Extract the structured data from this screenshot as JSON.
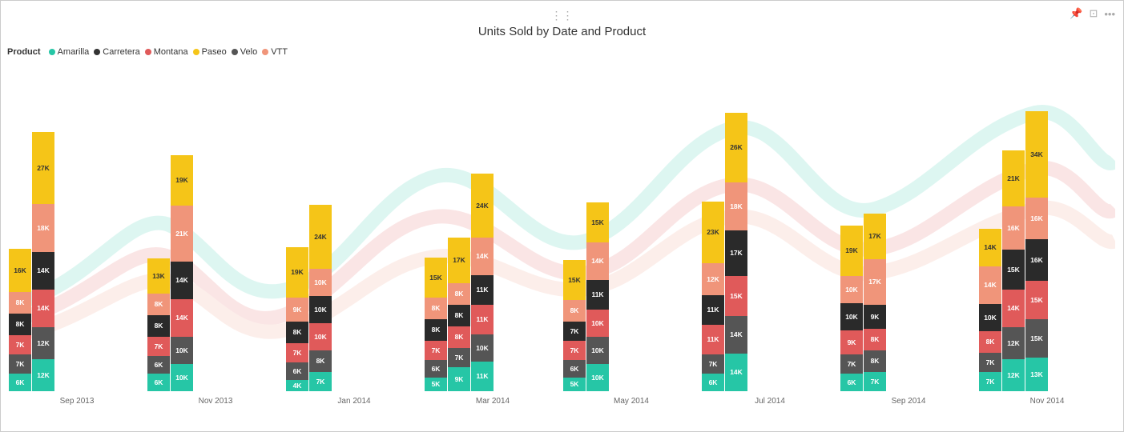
{
  "title": "Units Sold by Date and Product",
  "legend": {
    "label": "Product",
    "items": [
      {
        "name": "Amarilla",
        "color": "#26C6A6"
      },
      {
        "name": "Carretera",
        "color": "#333333"
      },
      {
        "name": "Montana",
        "color": "#E05A5A"
      },
      {
        "name": "Paseo",
        "color": "#F5C518"
      },
      {
        "name": "Velo",
        "color": "#555555"
      },
      {
        "name": "VTT",
        "color": "#F0957A"
      }
    ]
  },
  "colors": {
    "Amarilla": "#26C6A6",
    "Carretera": "#2a2a2a",
    "Montana": "#E05A5A",
    "Paseo": "#F5C518",
    "Velo": "#555555",
    "VTT": "#F0957A"
  },
  "xLabels": [
    "Sep 2013",
    "Nov 2013",
    "Jan 2014",
    "Mar 2014",
    "May 2014",
    "Jul 2014",
    "Sep 2014",
    "Nov 2014"
  ],
  "groups": [
    {
      "label": "Sep 2013",
      "stacks": [
        {
          "segments": [
            {
              "product": "Amarilla",
              "value": "6K",
              "height": 22,
              "color": "#26C6A6"
            },
            {
              "product": "Velo",
              "value": "7K",
              "height": 24,
              "color": "#555555"
            },
            {
              "product": "Montana",
              "value": "7K",
              "height": 24,
              "color": "#E05A5A"
            },
            {
              "product": "Carretera",
              "value": "8K",
              "height": 27,
              "color": "#2a2a2a"
            },
            {
              "product": "VTT",
              "value": "8K",
              "height": 27,
              "color": "#F0957A"
            },
            {
              "product": "Paseo",
              "value": "16K",
              "height": 54,
              "color": "#F5C518"
            }
          ]
        },
        {
          "segments": [
            {
              "product": "Amarilla",
              "value": "12K",
              "height": 40,
              "color": "#26C6A6"
            },
            {
              "product": "Velo",
              "value": "12K",
              "height": 40,
              "color": "#555555"
            },
            {
              "product": "Montana",
              "value": "14K",
              "height": 47,
              "color": "#E05A5A"
            },
            {
              "product": "Carretera",
              "value": "14K",
              "height": 47,
              "color": "#2a2a2a"
            },
            {
              "product": "VTT",
              "value": "18K",
              "height": 60,
              "color": "#F0957A"
            },
            {
              "product": "Paseo",
              "value": "27K",
              "height": 90,
              "color": "#F5C518"
            }
          ]
        }
      ]
    },
    {
      "label": "Nov 2013",
      "stacks": [
        {
          "segments": [
            {
              "product": "Amarilla",
              "value": "6K",
              "height": 22,
              "color": "#26C6A6"
            },
            {
              "product": "Velo",
              "value": "6K",
              "height": 22,
              "color": "#555555"
            },
            {
              "product": "Montana",
              "value": "7K",
              "height": 24,
              "color": "#E05A5A"
            },
            {
              "product": "Carretera",
              "value": "8K",
              "height": 27,
              "color": "#2a2a2a"
            },
            {
              "product": "VTT",
              "value": "8K",
              "height": 27,
              "color": "#F0957A"
            },
            {
              "product": "Paseo",
              "value": "13K",
              "height": 44,
              "color": "#F5C518"
            }
          ]
        },
        {
          "segments": [
            {
              "product": "Amarilla",
              "value": "10K",
              "height": 34,
              "color": "#26C6A6"
            },
            {
              "product": "Velo",
              "value": "10K",
              "height": 34,
              "color": "#555555"
            },
            {
              "product": "Montana",
              "value": "14K",
              "height": 47,
              "color": "#E05A5A"
            },
            {
              "product": "Carretera",
              "value": "14K",
              "height": 47,
              "color": "#2a2a2a"
            },
            {
              "product": "VTT",
              "value": "21K",
              "height": 70,
              "color": "#F0957A"
            },
            {
              "product": "Paseo",
              "value": "19K",
              "height": 63,
              "color": "#F5C518"
            }
          ]
        }
      ]
    },
    {
      "label": "Jan 2014",
      "stacks": [
        {
          "segments": [
            {
              "product": "Amarilla",
              "value": "4K",
              "height": 14,
              "color": "#26C6A6"
            },
            {
              "product": "Velo",
              "value": "6K",
              "height": 22,
              "color": "#555555"
            },
            {
              "product": "Montana",
              "value": "7K",
              "height": 24,
              "color": "#E05A5A"
            },
            {
              "product": "Carretera",
              "value": "8K",
              "height": 27,
              "color": "#2a2a2a"
            },
            {
              "product": "VTT",
              "value": "9K",
              "height": 30,
              "color": "#F0957A"
            },
            {
              "product": "Paseo",
              "value": "19K",
              "height": 63,
              "color": "#F5C518"
            }
          ]
        },
        {
          "segments": [
            {
              "product": "Amarilla",
              "value": "7K",
              "height": 24,
              "color": "#26C6A6"
            },
            {
              "product": "Velo",
              "value": "8K",
              "height": 27,
              "color": "#555555"
            },
            {
              "product": "Montana",
              "value": "10K",
              "height": 34,
              "color": "#E05A5A"
            },
            {
              "product": "Carretera",
              "value": "10K",
              "height": 34,
              "color": "#2a2a2a"
            },
            {
              "product": "VTT",
              "value": "10K",
              "height": 34,
              "color": "#F0957A"
            },
            {
              "product": "Paseo",
              "value": "24K",
              "height": 80,
              "color": "#F5C518"
            }
          ]
        }
      ]
    },
    {
      "label": "Mar 2014",
      "stacks": [
        {
          "segments": [
            {
              "product": "Amarilla",
              "value": "5K",
              "height": 17,
              "color": "#26C6A6"
            },
            {
              "product": "Velo",
              "value": "6K",
              "height": 22,
              "color": "#555555"
            },
            {
              "product": "Montana",
              "value": "7K",
              "height": 24,
              "color": "#E05A5A"
            },
            {
              "product": "Carretera",
              "value": "8K",
              "height": 27,
              "color": "#2a2a2a"
            },
            {
              "product": "VTT",
              "value": "8K",
              "height": 27,
              "color": "#F0957A"
            },
            {
              "product": "Paseo",
              "value": "15K",
              "height": 50,
              "color": "#F5C518"
            }
          ]
        },
        {
          "segments": [
            {
              "product": "Amarilla",
              "value": "9K",
              "height": 30,
              "color": "#26C6A6"
            },
            {
              "product": "Velo",
              "value": "7K",
              "height": 24,
              "color": "#555555"
            },
            {
              "product": "Montana",
              "value": "8K",
              "height": 27,
              "color": "#E05A5A"
            },
            {
              "product": "Carretera",
              "value": "8K",
              "height": 27,
              "color": "#2a2a2a"
            },
            {
              "product": "VTT",
              "value": "8K",
              "height": 27,
              "color": "#F0957A"
            },
            {
              "product": "Paseo",
              "value": "17K",
              "height": 57,
              "color": "#F5C518"
            }
          ]
        },
        {
          "segments": [
            {
              "product": "Amarilla",
              "value": "11K",
              "height": 37,
              "color": "#26C6A6"
            },
            {
              "product": "Velo",
              "value": "10K",
              "height": 34,
              "color": "#555555"
            },
            {
              "product": "Montana",
              "value": "11K",
              "height": 37,
              "color": "#E05A5A"
            },
            {
              "product": "Carretera",
              "value": "11K",
              "height": 37,
              "color": "#2a2a2a"
            },
            {
              "product": "VTT",
              "value": "14K",
              "height": 47,
              "color": "#F0957A"
            },
            {
              "product": "Paseo",
              "value": "24K",
              "height": 80,
              "color": "#F5C518"
            }
          ]
        }
      ]
    },
    {
      "label": "May 2014",
      "stacks": [
        {
          "segments": [
            {
              "product": "Amarilla",
              "value": "5K",
              "height": 17,
              "color": "#26C6A6"
            },
            {
              "product": "Velo",
              "value": "6K",
              "height": 22,
              "color": "#555555"
            },
            {
              "product": "Montana",
              "value": "7K",
              "height": 24,
              "color": "#E05A5A"
            },
            {
              "product": "Carretera",
              "value": "7K",
              "height": 24,
              "color": "#2a2a2a"
            },
            {
              "product": "VTT",
              "value": "8K",
              "height": 27,
              "color": "#F0957A"
            },
            {
              "product": "Paseo",
              "value": "15K",
              "height": 50,
              "color": "#F5C518"
            }
          ]
        },
        {
          "segments": [
            {
              "product": "Amarilla",
              "value": "10K",
              "height": 34,
              "color": "#26C6A6"
            },
            {
              "product": "Velo",
              "value": "10K",
              "height": 34,
              "color": "#555555"
            },
            {
              "product": "Montana",
              "value": "10K",
              "height": 34,
              "color": "#E05A5A"
            },
            {
              "product": "Carretera",
              "value": "11K",
              "height": 37,
              "color": "#2a2a2a"
            },
            {
              "product": "VTT",
              "value": "14K",
              "height": 47,
              "color": "#F0957A"
            },
            {
              "product": "Paseo",
              "value": "15K",
              "height": 50,
              "color": "#F5C518"
            }
          ]
        }
      ]
    },
    {
      "label": "Jul 2014",
      "stacks": [
        {
          "segments": [
            {
              "product": "Amarilla",
              "value": "6K",
              "height": 22,
              "color": "#26C6A6"
            },
            {
              "product": "Velo",
              "value": "7K",
              "height": 24,
              "color": "#555555"
            },
            {
              "product": "Montana",
              "value": "11K",
              "height": 37,
              "color": "#E05A5A"
            },
            {
              "product": "Carretera",
              "value": "11K",
              "height": 37,
              "color": "#2a2a2a"
            },
            {
              "product": "VTT",
              "value": "12K",
              "height": 40,
              "color": "#F0957A"
            },
            {
              "product": "Paseo",
              "value": "23K",
              "height": 77,
              "color": "#F5C518"
            }
          ]
        },
        {
          "segments": [
            {
              "product": "Amarilla",
              "value": "14K",
              "height": 47,
              "color": "#26C6A6"
            },
            {
              "product": "Velo",
              "value": "14K",
              "height": 47,
              "color": "#555555"
            },
            {
              "product": "Montana",
              "value": "15K",
              "height": 50,
              "color": "#E05A5A"
            },
            {
              "product": "Carretera",
              "value": "17K",
              "height": 57,
              "color": "#2a2a2a"
            },
            {
              "product": "VTT",
              "value": "18K",
              "height": 60,
              "color": "#F0957A"
            },
            {
              "product": "Paseo",
              "value": "26K",
              "height": 87,
              "color": "#F5C518"
            }
          ]
        }
      ]
    },
    {
      "label": "Sep 2014",
      "stacks": [
        {
          "segments": [
            {
              "product": "Amarilla",
              "value": "6K",
              "height": 22,
              "color": "#26C6A6"
            },
            {
              "product": "Velo",
              "value": "7K",
              "height": 24,
              "color": "#555555"
            },
            {
              "product": "Montana",
              "value": "9K",
              "height": 30,
              "color": "#E05A5A"
            },
            {
              "product": "Carretera",
              "value": "10K",
              "height": 34,
              "color": "#2a2a2a"
            },
            {
              "product": "VTT",
              "value": "10K",
              "height": 34,
              "color": "#F0957A"
            },
            {
              "product": "Paseo",
              "value": "19K",
              "height": 63,
              "color": "#F5C518"
            }
          ]
        },
        {
          "segments": [
            {
              "product": "Amarilla",
              "value": "7K",
              "height": 24,
              "color": "#26C6A6"
            },
            {
              "product": "Velo",
              "value": "8K",
              "height": 27,
              "color": "#555555"
            },
            {
              "product": "Montana",
              "value": "8K",
              "height": 27,
              "color": "#E05A5A"
            },
            {
              "product": "Carretera",
              "value": "9K",
              "height": 30,
              "color": "#2a2a2a"
            },
            {
              "product": "VTT",
              "value": "17K",
              "height": 57,
              "color": "#F0957A"
            },
            {
              "product": "Paseo",
              "value": "17K",
              "height": 57,
              "color": "#F5C518"
            }
          ]
        }
      ]
    },
    {
      "label": "Nov 2014",
      "stacks": [
        {
          "segments": [
            {
              "product": "Amarilla",
              "value": "7K",
              "height": 24,
              "color": "#26C6A6"
            },
            {
              "product": "Velo",
              "value": "7K",
              "height": 24,
              "color": "#555555"
            },
            {
              "product": "Montana",
              "value": "8K",
              "height": 27,
              "color": "#E05A5A"
            },
            {
              "product": "Carretera",
              "value": "10K",
              "height": 34,
              "color": "#2a2a2a"
            },
            {
              "product": "VTT",
              "value": "14K",
              "height": 47,
              "color": "#F0957A"
            },
            {
              "product": "Paseo",
              "value": "14K",
              "height": 47,
              "color": "#F5C518"
            }
          ]
        },
        {
          "segments": [
            {
              "product": "Amarilla",
              "value": "12K",
              "height": 40,
              "color": "#26C6A6"
            },
            {
              "product": "Velo",
              "value": "12K",
              "height": 40,
              "color": "#555555"
            },
            {
              "product": "Montana",
              "value": "14K",
              "height": 47,
              "color": "#E05A5A"
            },
            {
              "product": "Carretera",
              "value": "15K",
              "height": 50,
              "color": "#2a2a2a"
            },
            {
              "product": "VTT",
              "value": "16K",
              "height": 54,
              "color": "#F0957A"
            },
            {
              "product": "Paseo",
              "value": "21K",
              "height": 70,
              "color": "#F5C518"
            }
          ]
        },
        {
          "segments": [
            {
              "product": "Amarilla",
              "value": "13K",
              "height": 44,
              "color": "#26C6A6"
            },
            {
              "product": "Velo",
              "value": "15K",
              "height": 50,
              "color": "#555555"
            },
            {
              "product": "Montana",
              "value": "15K",
              "height": 50,
              "color": "#E05A5A"
            },
            {
              "product": "Carretera",
              "value": "16K",
              "height": 54,
              "color": "#2a2a2a"
            },
            {
              "product": "VTT",
              "value": "16K",
              "height": 54,
              "color": "#F0957A"
            },
            {
              "product": "Paseo",
              "value": "34K",
              "height": 113,
              "color": "#F5C518"
            }
          ]
        }
      ]
    }
  ]
}
